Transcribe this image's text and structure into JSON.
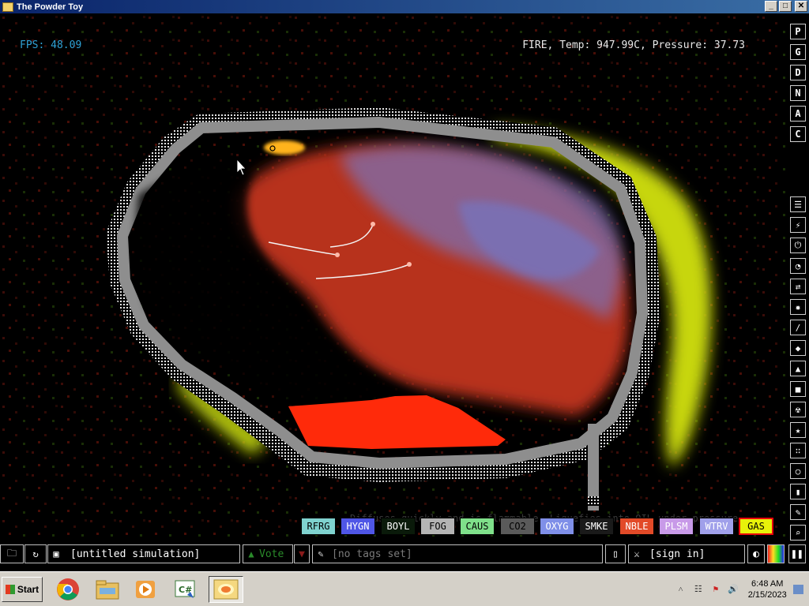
{
  "window": {
    "title": "The Powder Toy",
    "minimize": "_",
    "maximize": "□",
    "close": "✕"
  },
  "hud": {
    "fps": "FPS: 48.09",
    "info": "FIRE, Temp: 947.99C, Pressure: 37.73",
    "description": "Diffuses quickly and is flammable. Liquefies into OIL under pressure."
  },
  "render_modes": [
    "P",
    "G",
    "D",
    "N",
    "A",
    "C"
  ],
  "categories": [
    {
      "icon": "walls-icon",
      "glyph": "☰"
    },
    {
      "icon": "electronics-icon",
      "glyph": "⚡"
    },
    {
      "icon": "powered-icon",
      "glyph": "⏻"
    },
    {
      "icon": "sensors-icon",
      "glyph": "◔"
    },
    {
      "icon": "force-icon",
      "glyph": "⇄"
    },
    {
      "icon": "explosives-icon",
      "glyph": "✹"
    },
    {
      "icon": "gases-icon",
      "glyph": "/"
    },
    {
      "icon": "liquids-icon",
      "glyph": "◆"
    },
    {
      "icon": "powders-icon",
      "glyph": "▲"
    },
    {
      "icon": "solids-icon",
      "glyph": "■"
    },
    {
      "icon": "radioactive-icon",
      "glyph": "☢"
    },
    {
      "icon": "special-icon",
      "glyph": "★"
    },
    {
      "icon": "life-icon",
      "glyph": "∷"
    },
    {
      "icon": "tools-icon",
      "glyph": "○"
    },
    {
      "icon": "favorites-icon",
      "glyph": "▮"
    },
    {
      "icon": "decoration-icon",
      "glyph": "✎"
    },
    {
      "icon": "search-icon",
      "glyph": "⌕"
    }
  ],
  "elements": [
    {
      "label": "RFRG",
      "bg": "#7fd2cf",
      "fg": "#000000"
    },
    {
      "label": "HYGN",
      "bg": "#4f56e6",
      "fg": "#ffffff"
    },
    {
      "label": "BOYL",
      "bg": "#0a1a0a",
      "fg": "#ffffff"
    },
    {
      "label": "FOG",
      "bg": "#b4b4b4",
      "fg": "#000000"
    },
    {
      "label": "CAUS",
      "bg": "#7fe08a",
      "fg": "#000000"
    },
    {
      "label": "CO2",
      "bg": "#5a5a5a",
      "fg": "#000000"
    },
    {
      "label": "OXYG",
      "bg": "#7f8fe8",
      "fg": "#ffffff"
    },
    {
      "label": "SMKE",
      "bg": "#1a1a1a",
      "fg": "#ffffff"
    },
    {
      "label": "NBLE",
      "bg": "#e24a28",
      "fg": "#ffffff"
    },
    {
      "label": "PLSM",
      "bg": "#c89ae8",
      "fg": "#ffffff"
    },
    {
      "label": "WTRV",
      "bg": "#a0a0ea",
      "fg": "#ffffff"
    },
    {
      "label": "GAS",
      "bg": "#e8f20a",
      "fg": "#000000",
      "selected": true
    }
  ],
  "statusbar": {
    "sim_name": "[untitled simulation]",
    "vote": "Vote",
    "tags": "[no tags set]",
    "sign_in": "[sign in]"
  },
  "taskbar": {
    "start": "Start",
    "apps": [
      "chrome-icon",
      "file-explorer-icon",
      "media-player-icon",
      "csharp-icon",
      "powder-toy-icon"
    ],
    "time": "6:48 AM",
    "date": "2/15/2023"
  }
}
